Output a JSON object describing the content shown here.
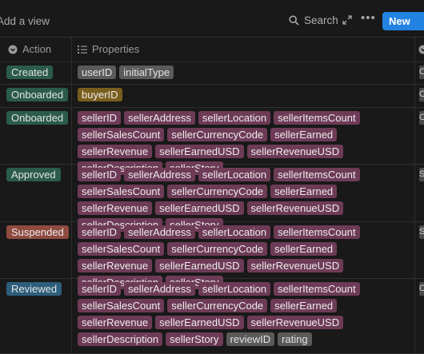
{
  "toolbar": {
    "add_view": "Add a view",
    "search": "Search",
    "new_label": "New"
  },
  "columns": {
    "action": "Action",
    "properties": "Properties"
  },
  "rows": [
    {
      "action": "Created",
      "color": "green",
      "props": [
        [
          "userID",
          "grey"
        ],
        [
          "initialType",
          "grey"
        ]
      ]
    },
    {
      "action": "Onboarded",
      "color": "green",
      "props": [
        [
          "buyerID",
          "yellow"
        ]
      ]
    },
    {
      "action": "Onboarded",
      "color": "green",
      "props": [
        [
          "sellerID",
          "pink"
        ],
        [
          "sellerAddress",
          "pink"
        ],
        [
          "sellerLocation",
          "pink"
        ],
        [
          "sellerItemsCount",
          "pink"
        ],
        [
          "sellerSalesCount",
          "pink"
        ],
        [
          "sellerCurrencyCode",
          "pink"
        ],
        [
          "sellerEarned",
          "pink"
        ],
        [
          "sellerRevenue",
          "pink"
        ],
        [
          "sellerEarnedUSD",
          "pink"
        ],
        [
          "sellerRevenueUSD",
          "pink"
        ],
        [
          "sellerDescription",
          "pink"
        ],
        [
          "sellerStory",
          "pink"
        ]
      ]
    },
    {
      "action": "Approved",
      "color": "green",
      "props": [
        [
          "sellerID",
          "pink"
        ],
        [
          "sellerAddress",
          "pink"
        ],
        [
          "sellerLocation",
          "pink"
        ],
        [
          "sellerItemsCount",
          "pink"
        ],
        [
          "sellerSalesCount",
          "pink"
        ],
        [
          "sellerCurrencyCode",
          "pink"
        ],
        [
          "sellerEarned",
          "pink"
        ],
        [
          "sellerRevenue",
          "pink"
        ],
        [
          "sellerEarnedUSD",
          "pink"
        ],
        [
          "sellerRevenueUSD",
          "pink"
        ],
        [
          "sellerDescription",
          "pink"
        ],
        [
          "sellerStory",
          "pink"
        ]
      ]
    },
    {
      "action": "Suspended",
      "color": "red",
      "props": [
        [
          "sellerID",
          "pink"
        ],
        [
          "sellerAddress",
          "pink"
        ],
        [
          "sellerLocation",
          "pink"
        ],
        [
          "sellerItemsCount",
          "pink"
        ],
        [
          "sellerSalesCount",
          "pink"
        ],
        [
          "sellerCurrencyCode",
          "pink"
        ],
        [
          "sellerEarned",
          "pink"
        ],
        [
          "sellerRevenue",
          "pink"
        ],
        [
          "sellerEarnedUSD",
          "pink"
        ],
        [
          "sellerRevenueUSD",
          "pink"
        ],
        [
          "sellerDescription",
          "pink"
        ],
        [
          "sellerStory",
          "pink"
        ]
      ]
    },
    {
      "action": "Reviewed",
      "color": "blue",
      "props": [
        [
          "sellerID",
          "pink"
        ],
        [
          "sellerAddress",
          "pink"
        ],
        [
          "sellerLocation",
          "pink"
        ],
        [
          "sellerItemsCount",
          "pink"
        ],
        [
          "sellerSalesCount",
          "pink"
        ],
        [
          "sellerCurrencyCode",
          "pink"
        ],
        [
          "sellerEarned",
          "pink"
        ],
        [
          "sellerRevenue",
          "pink"
        ],
        [
          "sellerEarnedUSD",
          "pink"
        ],
        [
          "sellerRevenueUSD",
          "pink"
        ],
        [
          "sellerDescription",
          "pink"
        ],
        [
          "sellerStory",
          "pink"
        ],
        [
          "reviewID",
          "grey"
        ],
        [
          "rating",
          "grey"
        ]
      ]
    }
  ],
  "edge_cells": [
    "C",
    "C",
    "C",
    "S",
    "S",
    "C"
  ]
}
